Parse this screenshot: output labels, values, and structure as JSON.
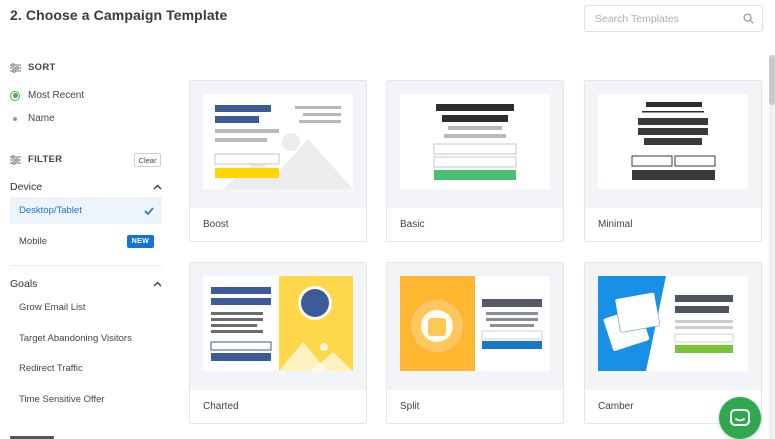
{
  "header": {
    "title": "2. Choose a Campaign Template"
  },
  "search": {
    "placeholder": "Search Templates",
    "value": ""
  },
  "sidebar": {
    "sort": {
      "label": "SORT",
      "options": [
        {
          "label": "Most Recent",
          "selected": true
        },
        {
          "label": "Name",
          "selected": false
        }
      ]
    },
    "filter": {
      "label": "FILTER",
      "clear_label": "Clear"
    },
    "device": {
      "label": "Device",
      "items": [
        {
          "label": "Desktop/Tablet",
          "active": true
        },
        {
          "label": "Mobile",
          "badge": "NEW"
        }
      ]
    },
    "goals": {
      "label": "Goals",
      "items": [
        {
          "label": "Grow Email List"
        },
        {
          "label": "Target Abandoning Visitors"
        },
        {
          "label": "Redirect Traffic"
        },
        {
          "label": "Time Sensitive Offer"
        }
      ]
    }
  },
  "templates": [
    {
      "name": "Boost"
    },
    {
      "name": "Basic"
    },
    {
      "name": "Minimal"
    },
    {
      "name": "Charted"
    },
    {
      "name": "Split"
    },
    {
      "name": "Camber"
    }
  ],
  "colors": {
    "accent_blue": "#1574d4",
    "selected_green": "#4caf50",
    "chat_green": "#2fa84f",
    "navy": "#3d5a99",
    "yellow": "#ffd600",
    "orange": "#ffb732"
  },
  "icons": {
    "search": "magnifier-icon",
    "sort": "sliders-icon",
    "filter": "sliders-icon",
    "chevron": "chevron-up-icon",
    "check": "checkmark-icon",
    "chat": "chat-icon"
  }
}
